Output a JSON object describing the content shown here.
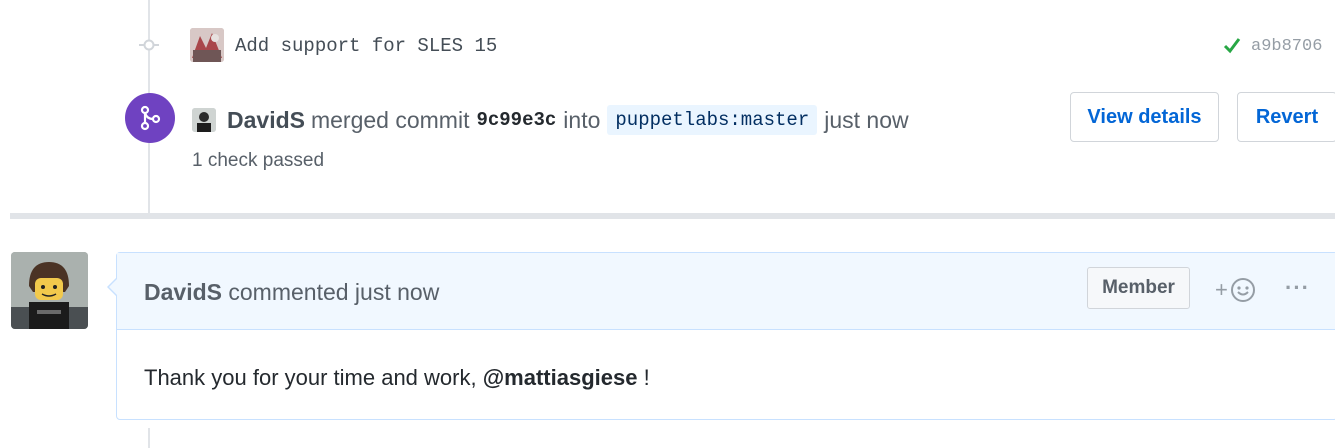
{
  "commit": {
    "message": "Add support for SLES 15",
    "sha": "a9b8706",
    "avatar_icon": "user-avatar-icon",
    "status_icon": "check-icon",
    "status_color": "#28a745"
  },
  "merge_event": {
    "icon": "git-merge-icon",
    "icon_color": "#6f42c1",
    "author": "DavidS",
    "action": "merged commit",
    "sha": "9c99e3c",
    "into_label": "into",
    "branch": "puppetlabs:master",
    "time": "just now",
    "checks": "1 check passed",
    "view_details_label": "View details",
    "revert_label": "Revert"
  },
  "comment": {
    "author": "DavidS",
    "action": "commented just now",
    "badge": "Member",
    "reaction_plus": "+",
    "reaction_icon": "smiley-icon",
    "more": "···",
    "body_prefix": "Thank you for your time and work,",
    "mention": "@mattiasgiese",
    "body_suffix": "!"
  },
  "colors": {
    "link": "#0366d6",
    "comment_border": "#c8e1ff",
    "comment_header_bg": "#f1f8ff",
    "branch_bg": "#eaf5ff"
  }
}
